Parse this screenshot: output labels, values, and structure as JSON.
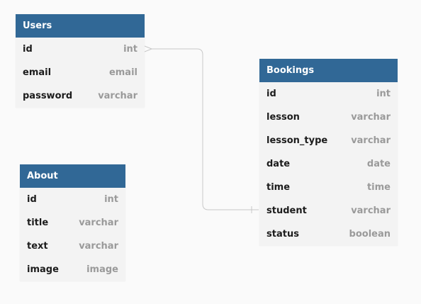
{
  "tables": {
    "users": {
      "title": "Users",
      "fields": [
        {
          "name": "id",
          "type": "int"
        },
        {
          "name": "email",
          "type": "email"
        },
        {
          "name": "password",
          "type": "varchar"
        }
      ]
    },
    "about": {
      "title": "About",
      "fields": [
        {
          "name": "id",
          "type": "int"
        },
        {
          "name": "title",
          "type": "varchar"
        },
        {
          "name": "text",
          "type": "varchar"
        },
        {
          "name": "image",
          "type": "image"
        }
      ]
    },
    "bookings": {
      "title": "Bookings",
      "fields": [
        {
          "name": "id",
          "type": "int"
        },
        {
          "name": "lesson",
          "type": "varchar"
        },
        {
          "name": "lesson_type",
          "type": "varchar"
        },
        {
          "name": "date",
          "type": "date"
        },
        {
          "name": "time",
          "type": "time"
        },
        {
          "name": "student",
          "type": "varchar"
        },
        {
          "name": "status",
          "type": "boolean"
        }
      ]
    }
  },
  "relationships": [
    {
      "from": "users.id",
      "to": "bookings.student",
      "from_cardinality": "many",
      "to_cardinality": "one"
    }
  ],
  "colors": {
    "header_bg": "#316896",
    "header_text": "#ffffff",
    "body_bg": "#f3f3f3",
    "field_name": "#1c1c1c",
    "field_type": "#9a9a9a",
    "connector": "#c8c8c8"
  }
}
